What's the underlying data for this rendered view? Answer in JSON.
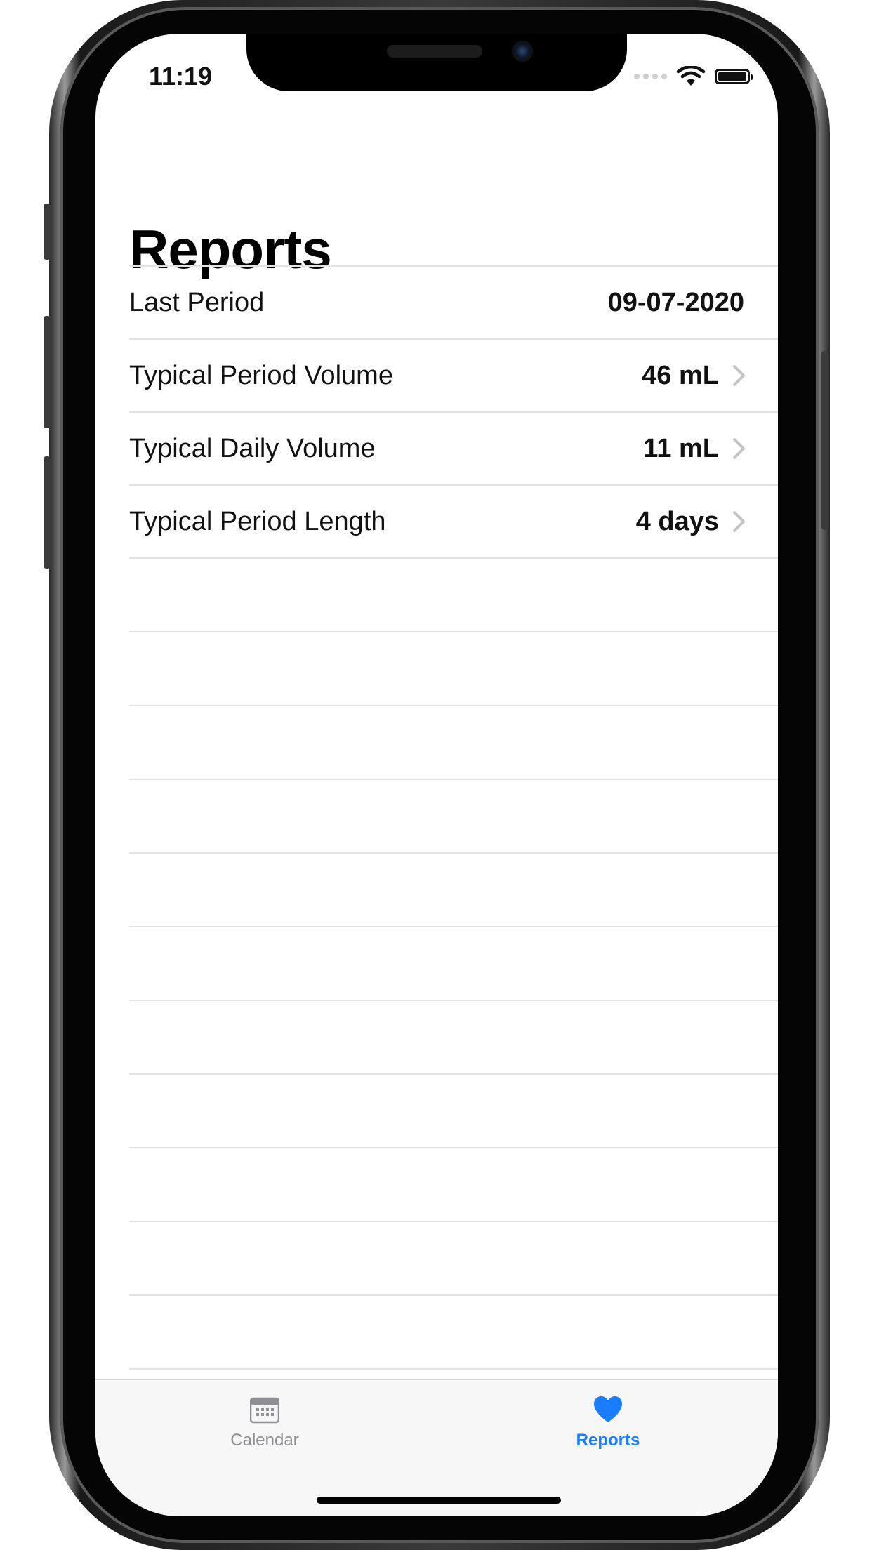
{
  "status_bar": {
    "time": "11:19"
  },
  "page": {
    "title": "Reports"
  },
  "rows": [
    {
      "label": "Last Period",
      "value": "09-07-2020",
      "has_disclosure": false
    },
    {
      "label": "Typical Period Volume",
      "value": "46 mL",
      "has_disclosure": true
    },
    {
      "label": "Typical Daily Volume",
      "value": "11 mL",
      "has_disclosure": true
    },
    {
      "label": "Typical Period Length",
      "value": "4 days",
      "has_disclosure": true
    }
  ],
  "tabbar": {
    "tabs": [
      {
        "label": "Calendar",
        "icon": "calendar-icon",
        "selected": false
      },
      {
        "label": "Reports",
        "icon": "heart-icon",
        "selected": true
      }
    ]
  },
  "colors": {
    "accent": "#1a7cff",
    "inactive_tab": "#8e8e93",
    "separator": "#e3e3e5",
    "tabbar_background": "#f7f7f7"
  }
}
